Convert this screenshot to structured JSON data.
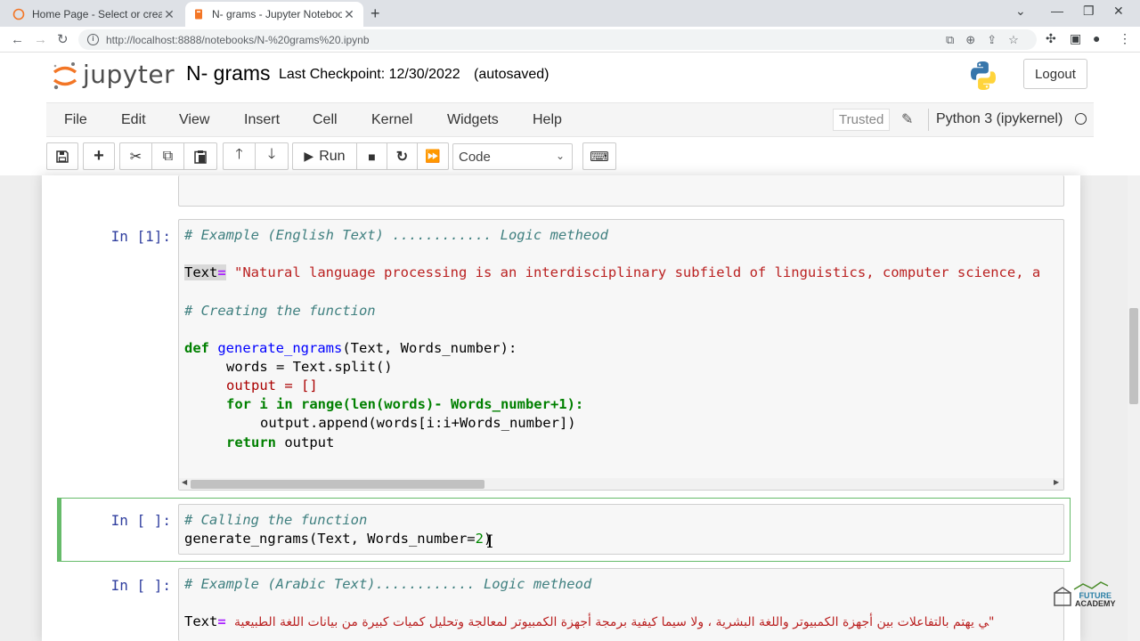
{
  "browser": {
    "tabs": [
      {
        "title": "Home Page - Select or create a n",
        "active": false
      },
      {
        "title": "N- grams - Jupyter Notebook",
        "active": true
      }
    ],
    "new_tab_label": "+",
    "url": "http://localhost:8888/notebooks/N-%20grams%20.ipynb"
  },
  "header": {
    "brand": "jupyter",
    "notebook_name": "N- grams",
    "checkpoint": "Last Checkpoint: 12/30/2022",
    "autosave": "(autosaved)",
    "logout_label": "Logout"
  },
  "menubar": {
    "items": [
      "File",
      "Edit",
      "View",
      "Insert",
      "Cell",
      "Kernel",
      "Widgets",
      "Help"
    ],
    "trusted_label": "Trusted",
    "kernel_name": "Python 3 (ipykernel)"
  },
  "toolbar": {
    "run_label": "Run",
    "cell_type": "Code"
  },
  "cells": [
    {
      "prompt": "In [1]:",
      "lines": {
        "l1": "# Example (English Text) ............ Logic metheod",
        "l2_var": "Text",
        "l2_op": "=",
        "l2_str": " \"Natural language processing is an interdisciplinary subfield of linguistics, computer science, a",
        "l3": "# Creating the function",
        "l4_def": "def",
        "l4_name": "generate_ngrams",
        "l4_args": "(Text, Words_number):",
        "l5": "words = Text.split()",
        "l6": "output = []",
        "l7": "for i in range(len(words)- Words_number+1):",
        "l8": "output.append(words[i:i+Words_number])",
        "l9_kw": "return",
        "l9_rest": " output"
      }
    },
    {
      "prompt": "In [ ]:",
      "lines": {
        "l1": "# Calling the function",
        "l2": "generate_ngrams(Text, Words_number=",
        "l2_num": "2",
        "l2_end": ")"
      }
    },
    {
      "prompt": "In [ ]:",
      "lines": {
        "l1": "# Example (Arabic Text)............ Logic metheod",
        "l2_var": "Text",
        "l2_op": "=",
        "l2_str": "ﻲ ﻳﻬﺘﻢ ﺑﺎﻟﺘﻔﺎﻋﻼﺕ ﺑﻴﻦ ﺃﺟﻬﺰﺓ ﺍﻟﻜﻤﺒﻴﻮﺗﺮ ﻭﺍﻟﻠﻐﺔ ﺍﻟﺒﺸﺮﻳﺔ ، ﻭﻻ ﺳﻴﻤﺎ ﻛﻴﻔﻴﺔ ﺑﺮﻣﺠﺔ ﺃﺟﻬﺰﺓ ﺍﻟﻜﻤﺒﻴﻮﺗﺮ ﻟﻤﻌﺎﻟﺠﺔ ﻭﺗﺤﻠﻴﻞ ﻛﻤﻴﺎﺕ ﻛﺒﻴﺮﺓ ﻣﻦ ﺑﻴﺎﻧﺎﺕ ﺍﻟﻠﻐﺔ ﺍﻟﻄﺒﻴﻌﻴﺔ\""
      }
    }
  ],
  "watermark": {
    "line1": "FUTURE",
    "line2": "ACADEMY"
  },
  "colors": {
    "selected_cell_border": "#66bb6a",
    "prompt": "#303f9f",
    "comment": "#408080",
    "keyword": "#008000",
    "string": "#ba2121"
  }
}
